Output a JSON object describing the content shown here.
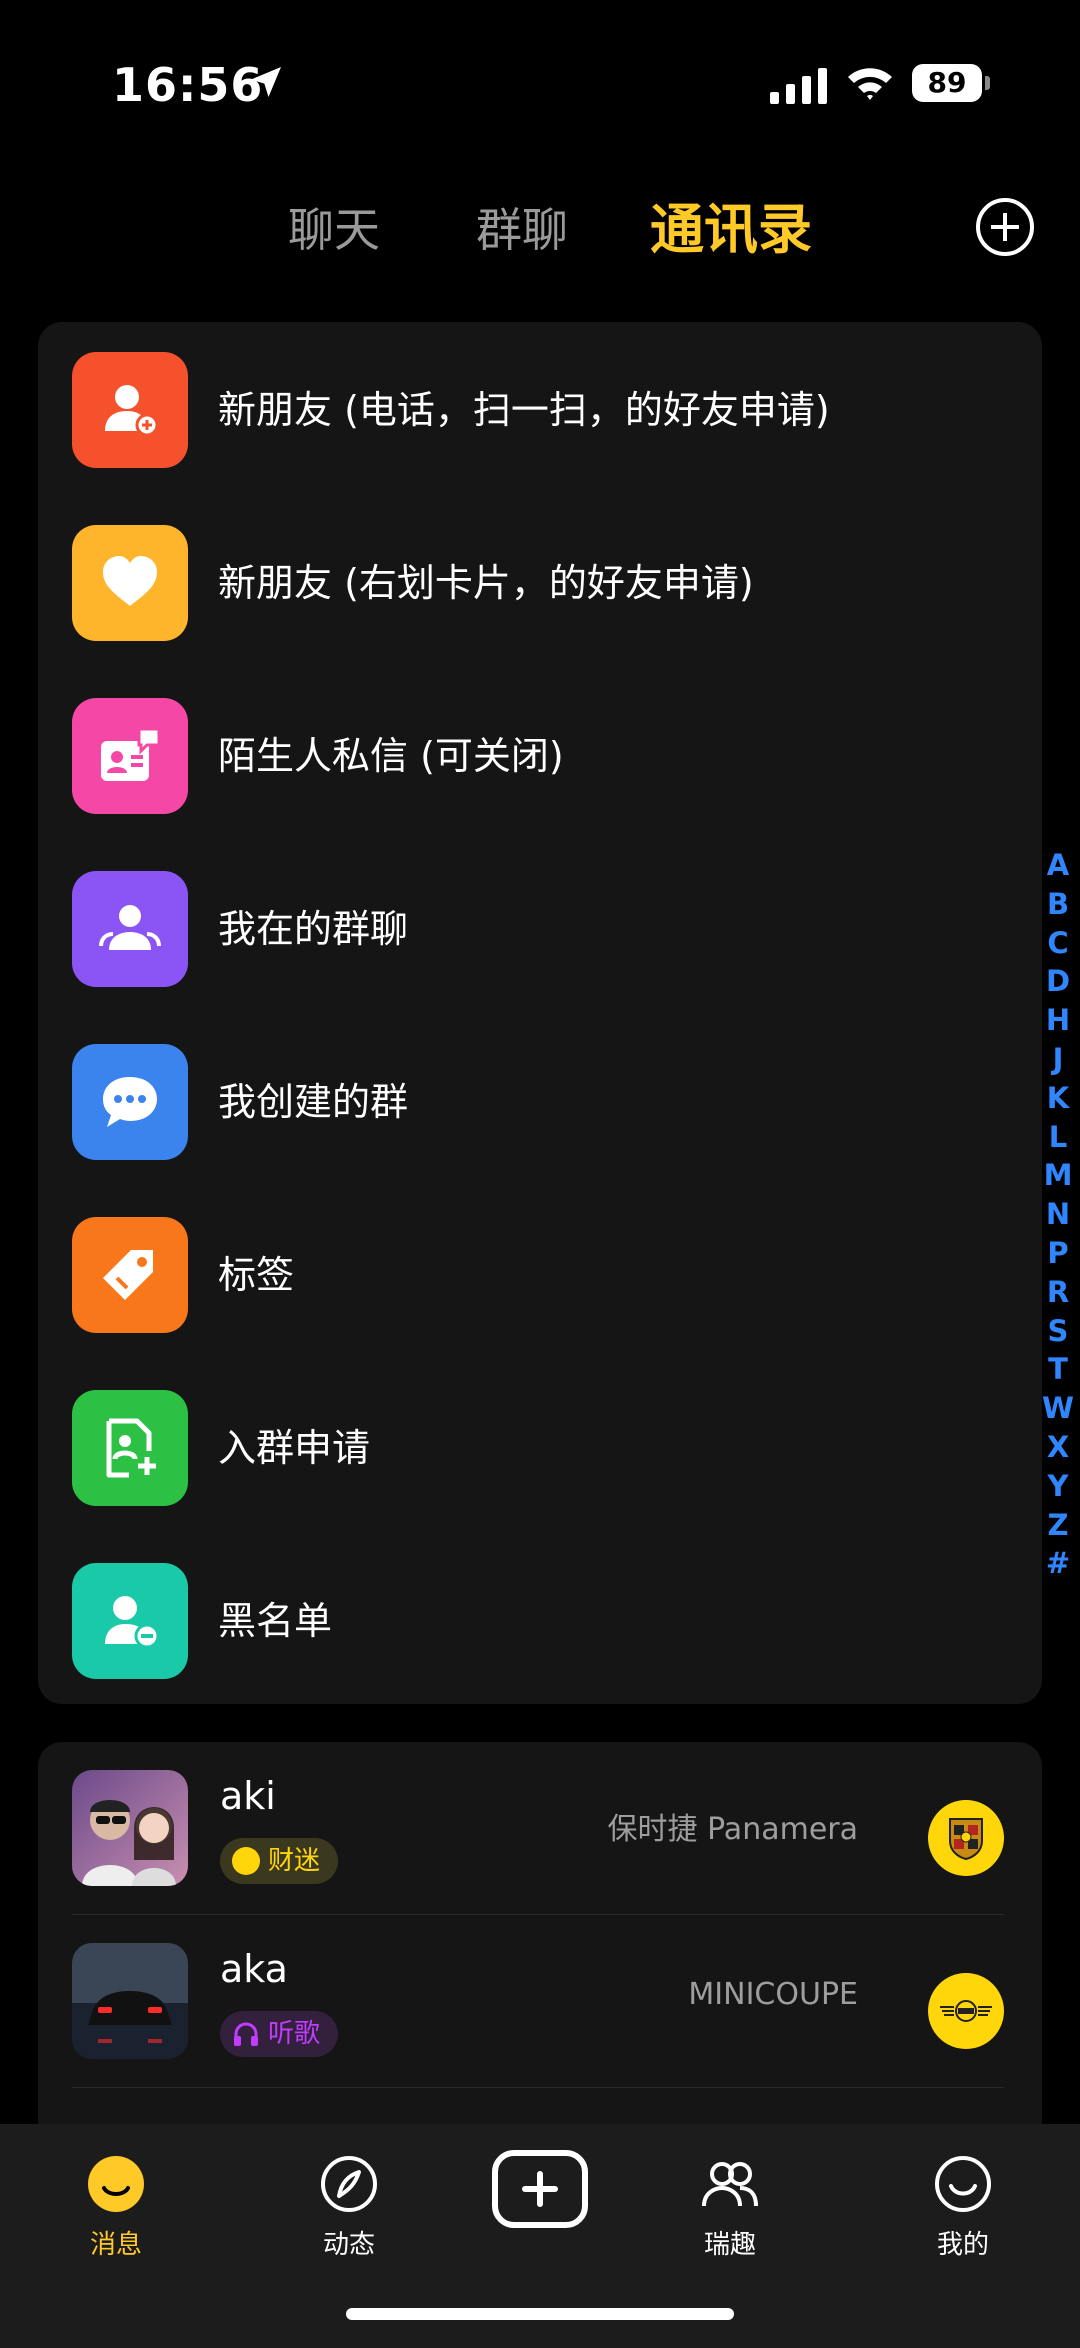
{
  "status_bar": {
    "time": "16:56",
    "battery": "89"
  },
  "tabs": [
    {
      "label": "聊天",
      "active": false
    },
    {
      "label": "群聊",
      "active": false
    },
    {
      "label": "通讯录",
      "active": true
    }
  ],
  "menu": [
    {
      "label": "新朋友 (电话，扫一扫，的好友申请)",
      "icon": "add-user-icon",
      "color": "#F4512C"
    },
    {
      "label": "新朋友 (右划卡片，的好友申请)",
      "icon": "heart-icon",
      "color": "#FFB52B"
    },
    {
      "label": "陌生人私信 (可关闭)",
      "icon": "stranger-message-icon",
      "color": "#F548A6"
    },
    {
      "label": "我在的群聊",
      "icon": "group-icon",
      "color": "#8B55F5"
    },
    {
      "label": "我创建的群",
      "icon": "chat-bubble-icon",
      "color": "#3B84EE"
    },
    {
      "label": "标签",
      "icon": "tag-icon",
      "color": "#F9771B"
    },
    {
      "label": "入群申请",
      "icon": "join-request-icon",
      "color": "#2CC144"
    },
    {
      "label": "黑名单",
      "icon": "blocklist-icon",
      "color": "#1AC9A8"
    }
  ],
  "index_letters": [
    "A",
    "B",
    "C",
    "D",
    "H",
    "J",
    "K",
    "L",
    "M",
    "N",
    "P",
    "R",
    "S",
    "T",
    "W",
    "X",
    "Y",
    "Z",
    "#"
  ],
  "contacts": [
    {
      "name": "aki",
      "badge": "财迷",
      "badge_color": "#FFD60A",
      "car": "保时捷 Panamera",
      "car_logo": "porsche-logo-icon"
    },
    {
      "name": "aka",
      "badge": "听歌",
      "badge_color": "#C13CFF",
      "car": "MINICOUPE",
      "car_logo": "mini-logo-icon"
    }
  ],
  "bottom_nav": [
    {
      "label": "消息",
      "icon": "message-smile-icon",
      "active": true
    },
    {
      "label": "动态",
      "icon": "compass-icon",
      "active": false
    },
    {
      "label": "",
      "icon": "add-icon",
      "active": false
    },
    {
      "label": "瑞趣",
      "icon": "people-icon",
      "active": false
    },
    {
      "label": "我的",
      "icon": "profile-smile-icon",
      "active": false
    }
  ],
  "colors": {
    "accent": "#FFC928",
    "index": "#2F86FF",
    "background": "#000000",
    "card": "#151515"
  }
}
